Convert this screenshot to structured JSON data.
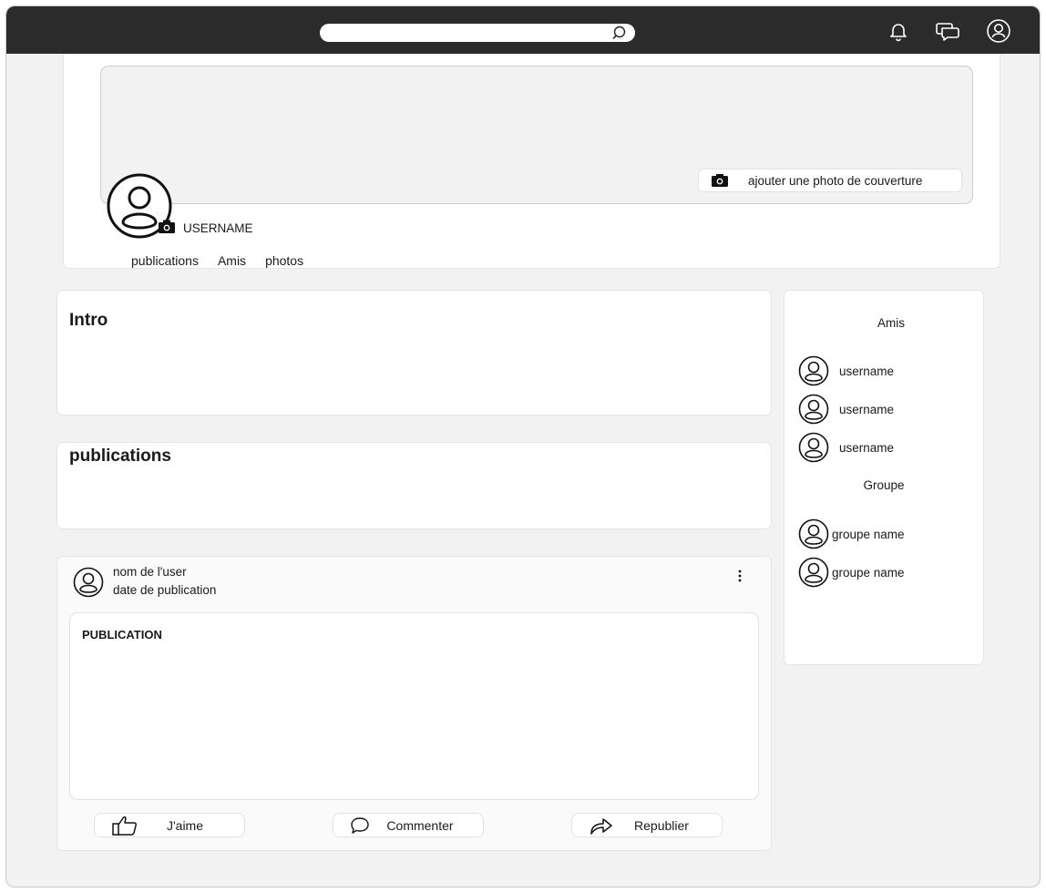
{
  "colors": {
    "topbar": "#2b2b2b",
    "background": "#f2f2f2",
    "card": "#ffffff"
  },
  "topbar": {
    "search": {
      "value": "",
      "icon": "search-icon"
    },
    "icons": [
      "bell-icon",
      "chat-icon",
      "user-icon"
    ]
  },
  "profile": {
    "cover_button_label": "ajouter une photo de couverture",
    "username": "USERNAME",
    "tabs": [
      "publications",
      "Amis",
      "photos"
    ]
  },
  "intro": {
    "title": "Intro"
  },
  "publications": {
    "title": "publications"
  },
  "post": {
    "author": "nom de l'user",
    "date": "date de publication",
    "content_title": "PUBLICATION",
    "actions": {
      "like": "J'aime",
      "comment": "Commenter",
      "share": "Republier"
    }
  },
  "sidebar": {
    "friends_title": "Amis",
    "friends": [
      "username",
      "username",
      "username"
    ],
    "groups_title": "Groupe",
    "groups": [
      "groupe name",
      "groupe name"
    ]
  }
}
